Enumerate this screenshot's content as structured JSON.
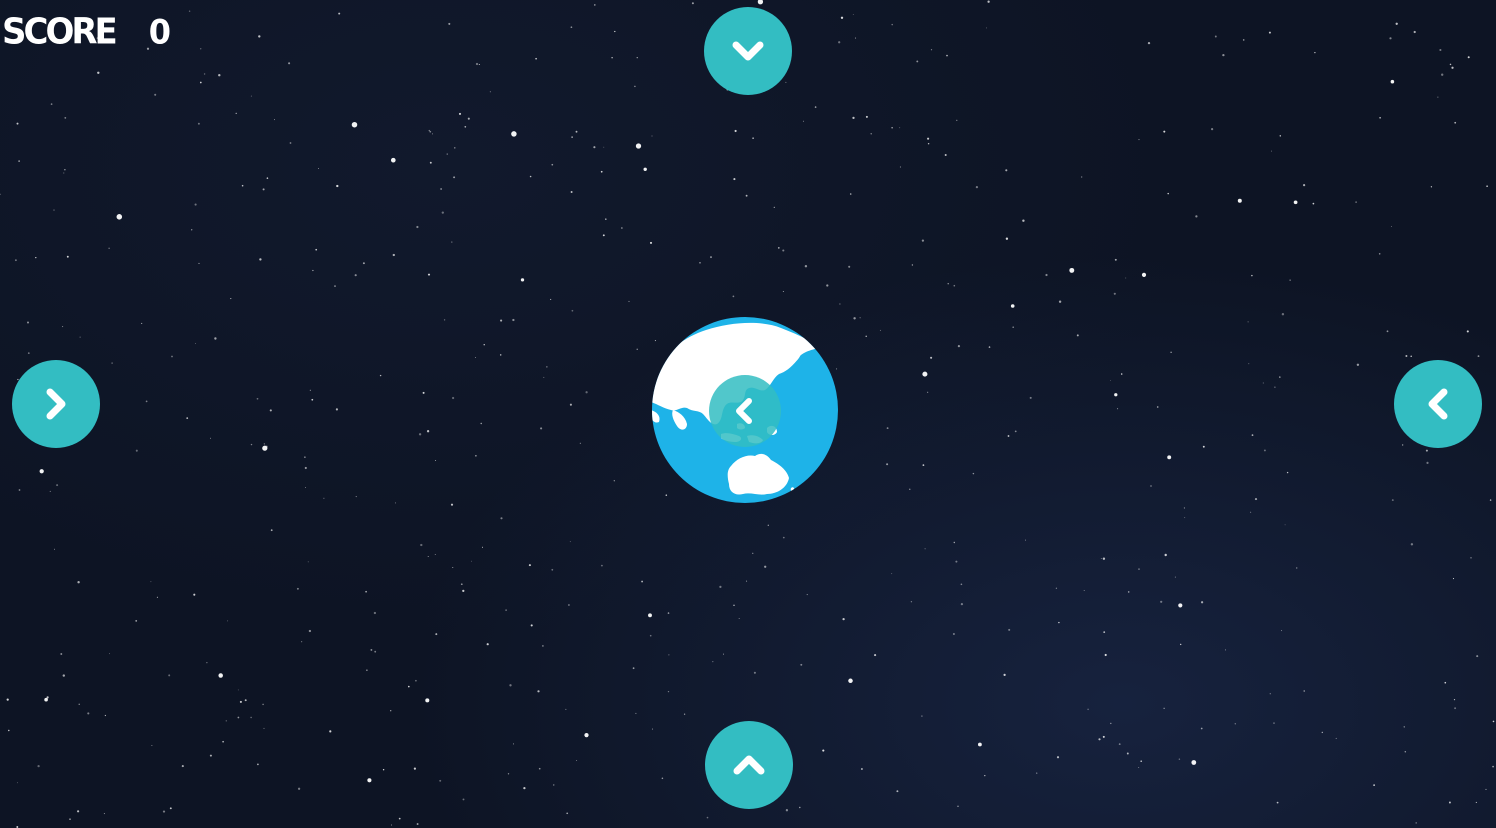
{
  "hud": {
    "score_label": "SCORE",
    "score_value": "0"
  },
  "colors": {
    "button": "#33bdc2",
    "ocean": "#1eb3e8",
    "land": "#ffffff",
    "sky": "#0d1424"
  },
  "controls": {
    "top": {
      "icon": "chevron-down-icon"
    },
    "bottom": {
      "icon": "chevron-up-icon"
    },
    "left": {
      "icon": "chevron-right-icon"
    },
    "right": {
      "icon": "chevron-left-icon"
    },
    "center": {
      "icon": "chevron-left-icon"
    }
  }
}
